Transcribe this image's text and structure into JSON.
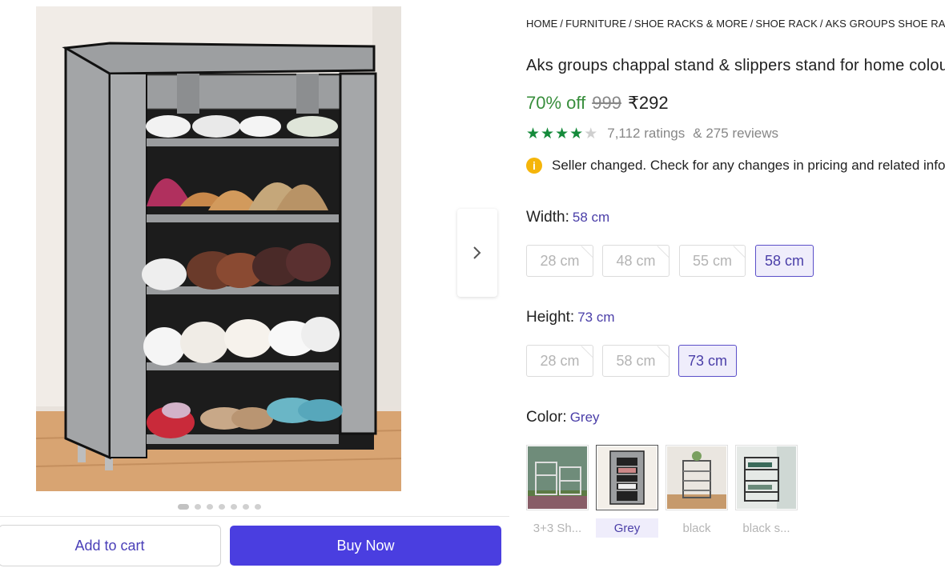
{
  "breadcrumb": [
    "HOME",
    "FURNITURE",
    "SHOE RACKS & MORE",
    "SHOE RACK",
    "AKS GROUPS SHOE RACK",
    ""
  ],
  "product": {
    "title": "Aks groups chappal stand & slippers stand for home colour grey",
    "discount": "70% off",
    "mrp": "999",
    "price": "₹292",
    "rating_stars": 4,
    "rating_max": 5,
    "ratings_text": "7,112 ratings",
    "reviews_text": "& 275 reviews",
    "notice": "Seller changed. Check for any changes in pricing and related information"
  },
  "width": {
    "label": "Width:",
    "selected": "58 cm",
    "options": [
      "28 cm",
      "48 cm",
      "55 cm",
      "58 cm"
    ]
  },
  "height": {
    "label": "Height:",
    "selected": "73 cm",
    "options": [
      "28 cm",
      "58 cm",
      "73 cm"
    ]
  },
  "color": {
    "label": "Color:",
    "selected": "Grey",
    "options": [
      "3+3 Sh...",
      "Grey",
      "black",
      "black s..."
    ]
  },
  "gallery": {
    "total_images": 7,
    "active_index": 0
  },
  "actions": {
    "add_to_cart": "Add to cart",
    "buy_now": "Buy Now"
  },
  "colors": {
    "accent": "#4a3ee0",
    "discount_green": "#388e3c",
    "star_green": "#148a3a",
    "selected_bg": "#efedfb"
  },
  "icons": {
    "next": "chevron-right-icon",
    "star": "star-icon",
    "info": "info-icon"
  }
}
